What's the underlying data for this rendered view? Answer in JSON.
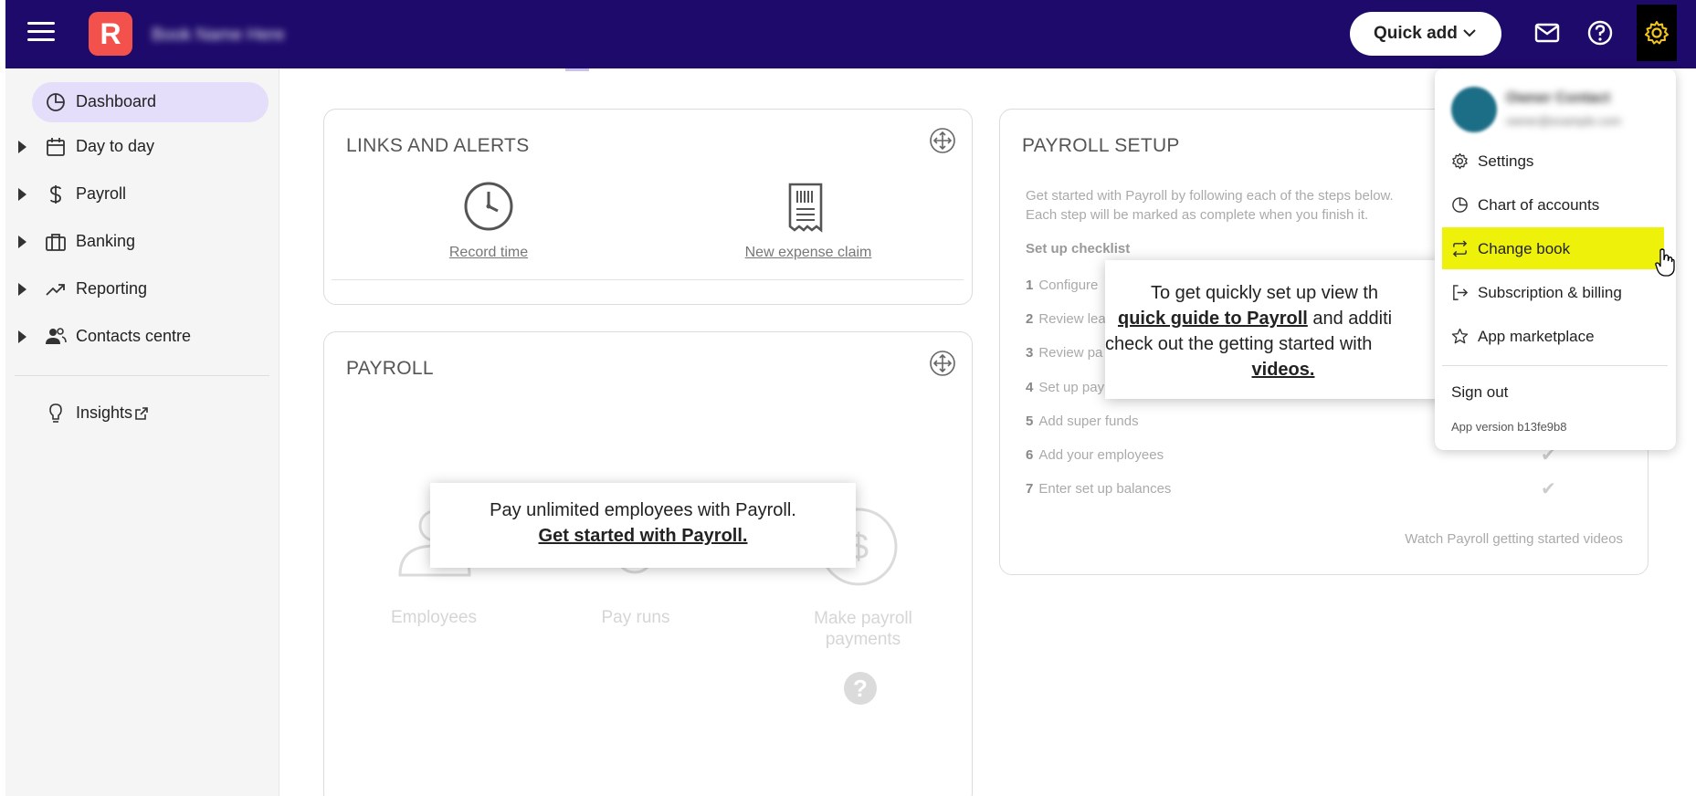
{
  "header": {
    "logo_letter": "R",
    "book_name": "Book Name Here",
    "quick_add_label": "Quick add",
    "colors": {
      "topbar": "#1d0a6b",
      "logo": "#f2524b",
      "highlight": "#eef10a"
    }
  },
  "sidebar": {
    "items": [
      {
        "label": "Dashboard",
        "icon": "pie-chart-icon",
        "active": true
      },
      {
        "label": "Day to day",
        "icon": "calendar-icon"
      },
      {
        "label": "Payroll",
        "icon": "dollar-icon"
      },
      {
        "label": "Banking",
        "icon": "briefcase-icon"
      },
      {
        "label": "Reporting",
        "icon": "trend-icon"
      },
      {
        "label": "Contacts centre",
        "icon": "people-icon"
      },
      {
        "label": "Insights",
        "icon": "lightbulb-icon"
      }
    ]
  },
  "links_card": {
    "title": "LINKS AND ALERTS",
    "record_time": "Record time",
    "new_expense": "New expense claim"
  },
  "payroll_card": {
    "title": "PAYROLL",
    "employees": "Employees",
    "pay_runs": "Pay runs",
    "make_payments": "Make payroll payments",
    "popup_line1": "Pay unlimited employees with Payroll.",
    "popup_link": "Get started with Payroll."
  },
  "setup_card": {
    "title": "PAYROLL SETUP",
    "intro1": "Get started with Payroll by following each of the steps below.",
    "intro2": "Each step will be marked as complete when you finish it.",
    "checklist_heading": "Set up checklist",
    "items": [
      {
        "num": "1",
        "text": "Configure"
      },
      {
        "num": "2",
        "text": "Review lea"
      },
      {
        "num": "3",
        "text": "Review pa"
      },
      {
        "num": "4",
        "text": "Set up pay"
      },
      {
        "num": "5",
        "text": "Add super funds"
      },
      {
        "num": "6",
        "text": "Add your employees"
      },
      {
        "num": "7",
        "text": "Enter set up balances"
      }
    ],
    "videos_link": "Watch Payroll getting started videos",
    "popup_line1": "To get quickly set up view th",
    "popup_link": "quick guide to Payroll",
    "popup_line2_rest": " and additi",
    "popup_line3": "check out the getting started with",
    "popup_link2": "videos."
  },
  "menu": {
    "user_name": "Owner Contact",
    "user_email": "owner@example.com",
    "items": [
      {
        "label": "Settings",
        "icon": "gear-icon"
      },
      {
        "label": "Chart of accounts",
        "icon": "pie-chart-icon"
      },
      {
        "label": "Change book",
        "icon": "swap-icon",
        "highlight": true
      },
      {
        "label": "Subscription & billing",
        "icon": "logout-arrow-icon"
      },
      {
        "label": "App marketplace",
        "icon": "star-icon"
      }
    ],
    "sign_out": "Sign out",
    "version": "App version b13fe9b8"
  }
}
